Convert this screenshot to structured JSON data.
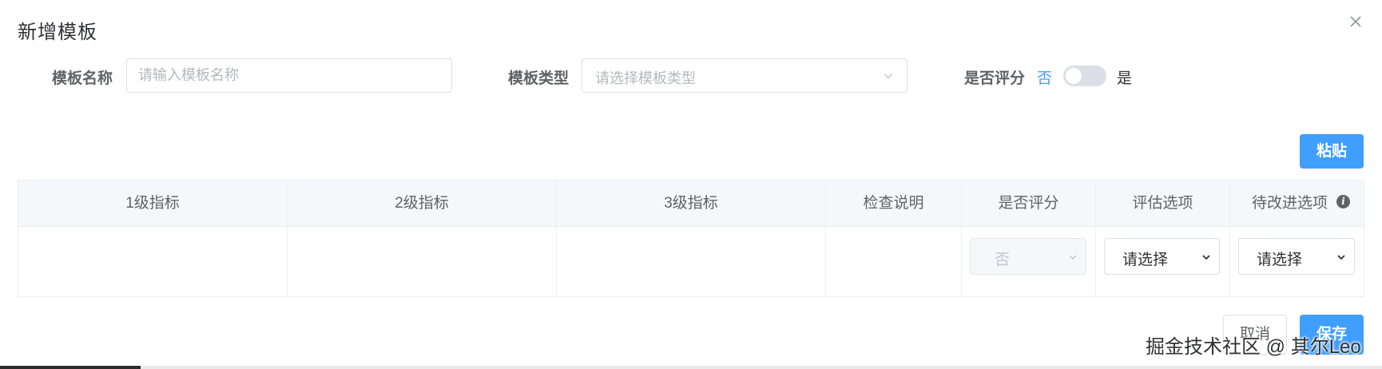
{
  "dialog": {
    "title": "新增模板",
    "close_icon": "close-icon"
  },
  "form": {
    "name_label": "模板名称",
    "name_placeholder": "请输入模板名称",
    "name_value": "",
    "type_label": "模板类型",
    "type_placeholder": "请选择模板类型",
    "score_label": "是否评分",
    "switch_off_label": "否",
    "switch_on_label": "是",
    "switch_checked": false
  },
  "toolbar": {
    "paste_label": "粘贴"
  },
  "table": {
    "headers": [
      "1级指标",
      "2级指标",
      "3级指标",
      "检查说明",
      "是否评分",
      "评估选项",
      "待改进选项"
    ],
    "header_info_icon": "info-icon",
    "rows": [
      {
        "level1": "",
        "level2": "",
        "level3": "",
        "check_desc": "",
        "is_scored": "否",
        "eval_option": "请选择",
        "improve_option": "请选择"
      }
    ]
  },
  "footer": {
    "cancel_label": "取消",
    "save_label": "保存"
  },
  "watermark": "掘金技术社区 @ 其尔Leo",
  "colors": {
    "primary": "#409eff",
    "header_bg": "#f5f7fa",
    "border": "#dcdfe6"
  }
}
